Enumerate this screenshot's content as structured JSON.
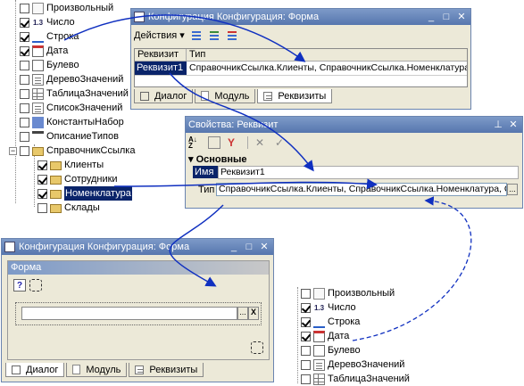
{
  "tree_top": {
    "items": [
      {
        "label": "Произвольный",
        "checked": false,
        "icon": "doc-icon"
      },
      {
        "label": "Число",
        "checked": true,
        "icon": "number-icon"
      },
      {
        "label": "Строка",
        "checked": true,
        "icon": "string-icon"
      },
      {
        "label": "Дата",
        "checked": true,
        "icon": "calendar-icon"
      },
      {
        "label": "Булево",
        "checked": false,
        "icon": "boolean-icon"
      },
      {
        "label": "ДеревоЗначений",
        "checked": false,
        "icon": "tree-icon"
      },
      {
        "label": "ТаблицаЗначений",
        "checked": false,
        "icon": "table-icon"
      },
      {
        "label": "СписокЗначений",
        "checked": false,
        "icon": "list-icon"
      },
      {
        "label": "КонстантыНабор",
        "checked": false,
        "icon": "constants-icon"
      },
      {
        "label": "ОписаниеТипов",
        "checked": false,
        "icon": "type-desc-icon"
      },
      {
        "label": "СправочникСсылка",
        "checked": false,
        "icon": "catalog-icon"
      },
      {
        "label": "Клиенты",
        "checked": true,
        "icon": "folder-icon"
      },
      {
        "label": "Сотрудники",
        "checked": true,
        "icon": "folder-icon"
      },
      {
        "label": "Номенклатура",
        "checked": true,
        "icon": "folder-icon",
        "selected": true
      },
      {
        "label": "Склады",
        "checked": false,
        "icon": "folder-icon"
      }
    ]
  },
  "form_window": {
    "title": "Конфигурация Конфигурация: Форма",
    "actions_label": "Действия",
    "columns": [
      "Реквизит",
      "Тип"
    ],
    "row": {
      "name": "Реквизит1",
      "type": "СправочникСсылка.Клиенты, СправочникСсылка.Номенклатура, ..."
    },
    "tabs": [
      "Диалог",
      "Модуль",
      "Реквизиты"
    ]
  },
  "props_window": {
    "title": "Свойства: Реквизит",
    "section": "Основные",
    "name_label": "Имя",
    "name_value": "Реквизит1",
    "type_label": "Тип",
    "type_value": "СправочникСсылка.Клиенты, СправочникСсылка.Номенклатура, Стро",
    "more": "..."
  },
  "dialog_window": {
    "title": "Конфигурация Конфигурация: Форма",
    "inner_title": "Форма",
    "help": "?",
    "tabs": [
      "Диалог",
      "Модуль",
      "Реквизиты"
    ],
    "button_more": "...",
    "button_clear": "X"
  },
  "tree_bottom": {
    "items": [
      {
        "label": "Произвольный",
        "checked": false
      },
      {
        "label": "Число",
        "checked": true
      },
      {
        "label": "Строка",
        "checked": true
      },
      {
        "label": "Дата",
        "checked": true
      },
      {
        "label": "Булево",
        "checked": false
      },
      {
        "label": "ДеревоЗначений",
        "checked": false
      },
      {
        "label": "ТаблицаЗначений",
        "checked": false
      }
    ]
  },
  "colors": {
    "title_bar": "#6784b8",
    "selection": "#0a246a",
    "arrow": "#1030c0"
  }
}
